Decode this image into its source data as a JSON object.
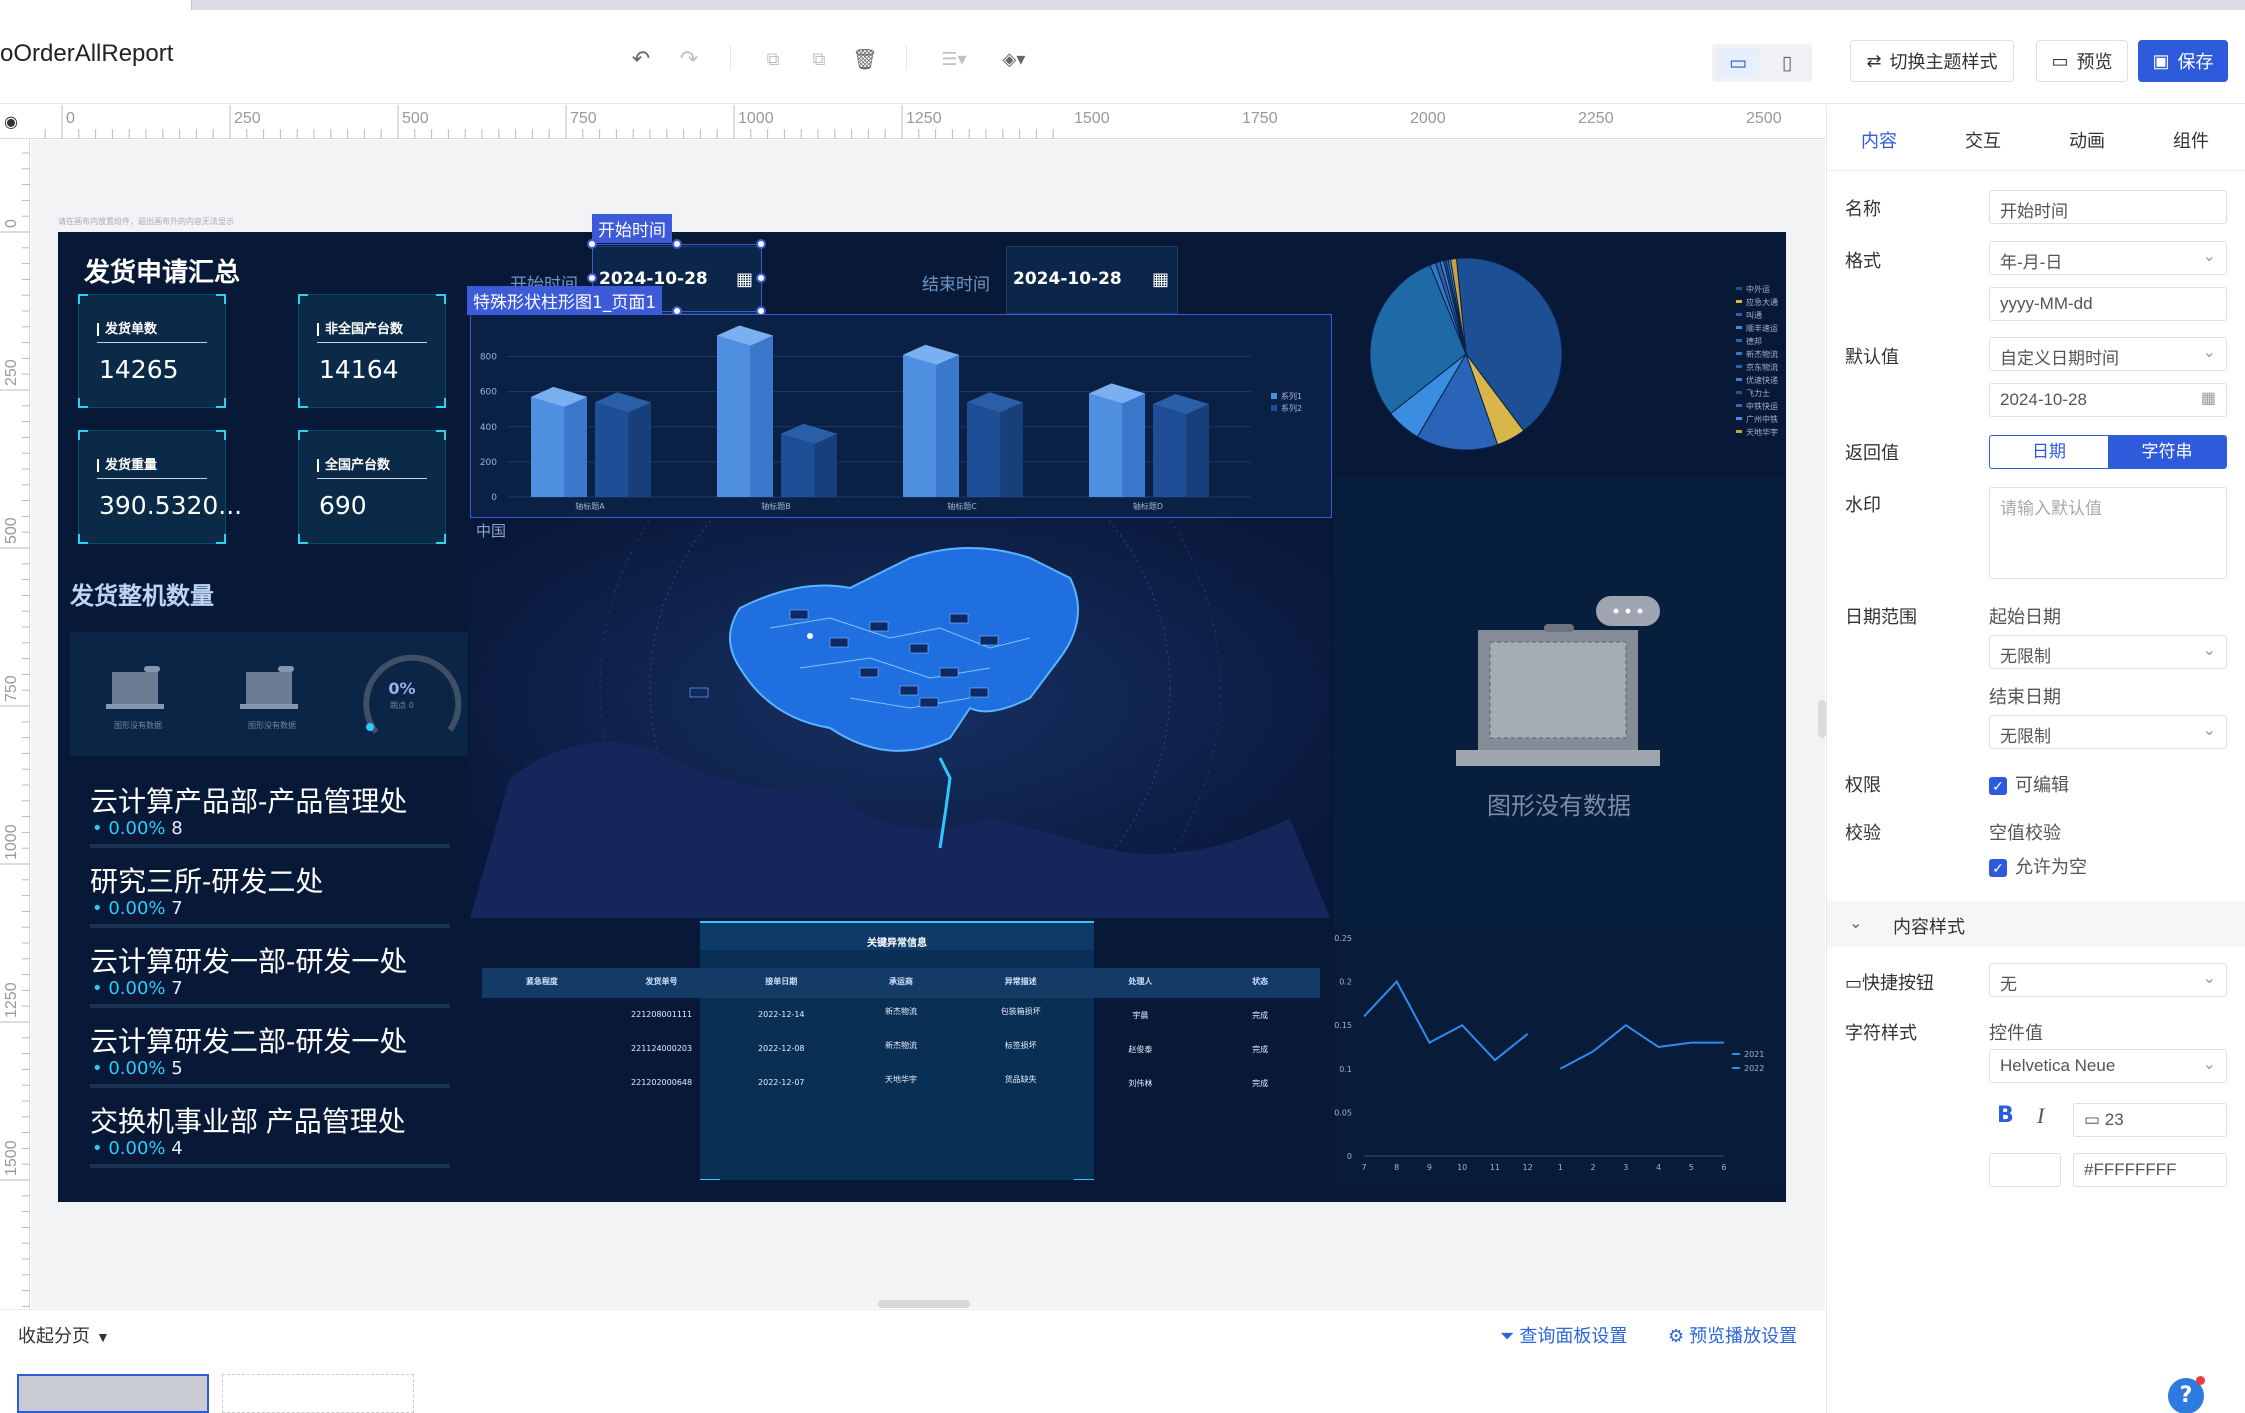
{
  "toolbar": {
    "title": "oOrderAllReport",
    "switch_theme": "切换主题样式",
    "preview": "预览",
    "save": "保存"
  },
  "ruler": {
    "h_ticks": [
      "0",
      "250",
      "500",
      "750",
      "1000",
      "1250",
      "1500",
      "1750",
      "2000",
      "2250",
      "2500"
    ],
    "v_ticks": [
      "0",
      "250",
      "500",
      "750",
      "1000",
      "1250",
      "1500"
    ]
  },
  "canvas": {
    "hint": "请在画布内放置组件，超出画布外的内容无法显示"
  },
  "dashboard": {
    "summary_title": "发货申请汇总",
    "kpis": [
      {
        "label": "发货单数",
        "value": "14265"
      },
      {
        "label": "非全国产台数",
        "value": "14164"
      },
      {
        "label": "发货重量",
        "value": "390.5320..."
      },
      {
        "label": "全国产台数",
        "value": "690"
      }
    ],
    "machine_title": "发货整机数量",
    "start_label": "开始时间",
    "start_date": "2024-10-28",
    "end_label": "结束时间",
    "end_date": "2024-10-28",
    "selected_label": "开始时间",
    "chart_sel_label": "特殊形状柱形图1_页面1",
    "map_label": "中国",
    "gauge_value": "0%",
    "gauge_sub": "跳点 0",
    "nodata_small": "图形没有数据",
    "nodata_text": "图形没有数据",
    "depts": [
      {
        "name": "云计算产品部-产品管理处",
        "pct": "0.00%",
        "count": "8"
      },
      {
        "name": "研究三所-研发二处",
        "pct": "0.00%",
        "count": "7"
      },
      {
        "name": "云计算研发一部-研发一处",
        "pct": "0.00%",
        "count": "7"
      },
      {
        "name": "云计算研发二部-研发一处",
        "pct": "0.00%",
        "count": "5"
      },
      {
        "name": "交换机事业部 产品管理处",
        "pct": "0.00%",
        "count": "4"
      }
    ],
    "table": {
      "title": "关键异常信息",
      "headers": [
        "紧急程度",
        "发货单号",
        "接单日期",
        "承运商",
        "异常描述",
        "处理人",
        "状态"
      ],
      "rows": [
        [
          "",
          "221208001111",
          "2022-12-14",
          "新杰物流",
          "包装箱损坏",
          "宇晨",
          "完成"
        ],
        [
          "",
          "221124000203",
          "2022-12-08",
          "新杰物流",
          "标签损坏",
          "赵俊泰",
          "完成"
        ],
        [
          "",
          "221202000648",
          "2022-12-07",
          "天地华宇",
          "货品缺失",
          "刘伟林",
          "完成"
        ]
      ]
    }
  },
  "chart_data": [
    {
      "type": "bar",
      "categories": [
        "轴标题A",
        "轴标题B",
        "轴标题C",
        "轴标题D"
      ],
      "series": [
        {
          "name": "系列1",
          "values": [
            570,
            920,
            810,
            590
          ]
        },
        {
          "name": "系列2",
          "values": [
            540,
            360,
            540,
            530
          ]
        }
      ],
      "yticks": [
        "0",
        "200",
        "400",
        "600",
        "800"
      ],
      "ylim": [
        0,
        900
      ],
      "legend": "right",
      "colors": [
        "#4f8fe0",
        "#1e4f96"
      ]
    },
    {
      "type": "pie",
      "legend": "right",
      "slices": [
        {
          "name": "中外运",
          "value": 42,
          "color": "#1c4f93"
        },
        {
          "name": "应急大通",
          "value": 5,
          "color": "#d9b64a"
        },
        {
          "name": "叫通",
          "value": 14,
          "color": "#2a64b8"
        },
        {
          "name": "顺丰速运",
          "value": 6,
          "color": "#3a8de0"
        },
        {
          "name": "德邦",
          "value": 30,
          "color": "#1e6aa6"
        },
        {
          "name": "新杰物流",
          "value": 1,
          "color": "#3578c8"
        },
        {
          "name": "京东物流",
          "value": 0.8,
          "color": "#2e5fa8"
        },
        {
          "name": "优速快递",
          "value": 0.6,
          "color": "#3d7fd2"
        },
        {
          "name": "飞力士",
          "value": 0.4,
          "color": "#22568f"
        },
        {
          "name": "中铁快运",
          "value": 0.4,
          "color": "#2b6cb8"
        },
        {
          "name": "广州中铁",
          "value": 0.4,
          "color": "#4a8ee0"
        },
        {
          "name": "天地华宇",
          "value": 1,
          "color": "#c8a140"
        }
      ]
    },
    {
      "type": "line",
      "x": [
        "7",
        "8",
        "9",
        "10",
        "11",
        "12",
        "1",
        "2",
        "3",
        "4",
        "5",
        "6"
      ],
      "series": [
        {
          "name": "2021",
          "values": [
            0.16,
            0.2,
            0.13,
            0.15,
            0.11,
            0.14,
            null,
            null,
            null,
            null,
            null,
            null
          ],
          "color": "#2d8cf0"
        },
        {
          "name": "2022",
          "values": [
            null,
            null,
            null,
            null,
            null,
            null,
            0.1,
            0.12,
            0.15,
            0.125,
            0.13,
            0.13
          ],
          "color": "#2d8cf0"
        }
      ],
      "yticks": [
        "0",
        "0.05",
        "0.1",
        "0.15",
        "0.2",
        "0.25"
      ],
      "ylim": [
        0,
        0.25
      ],
      "legend": "right"
    }
  ],
  "bottom": {
    "collapse": "收起分页",
    "query_settings": "查询面板设置",
    "preview_settings": "预览播放设置"
  },
  "panel": {
    "tabs": [
      "内容",
      "交互",
      "动画",
      "组件"
    ],
    "name_label": "名称",
    "name_value": "开始时间",
    "format_label": "格式",
    "format_value": "年-月-日",
    "format_pattern": "yyyy-MM-dd",
    "default_label": "默认值",
    "default_value": "自定义日期时间",
    "default_date": "2024-10-28",
    "return_label": "返回值",
    "return_date": "日期",
    "return_string": "字符串",
    "watermark_label": "水印",
    "watermark_placeholder": "请输入默认值",
    "range_label": "日期范围",
    "range_start_label": "起始日期",
    "range_start_value": "无限制",
    "range_end_label": "结束日期",
    "range_end_value": "无限制",
    "perm_label": "权限",
    "perm_value": "可编辑",
    "valid_label": "校验",
    "valid_sub": "空值校验",
    "valid_value": "允许为空",
    "content_style": "内容样式",
    "quick_label": "快捷按钮",
    "quick_value": "无",
    "font_label": "字符样式",
    "font_sub": "控件值",
    "font_family": "Helvetica Neue",
    "font_size": "23",
    "font_color": "#FFFFFFFF",
    "help": "?"
  }
}
